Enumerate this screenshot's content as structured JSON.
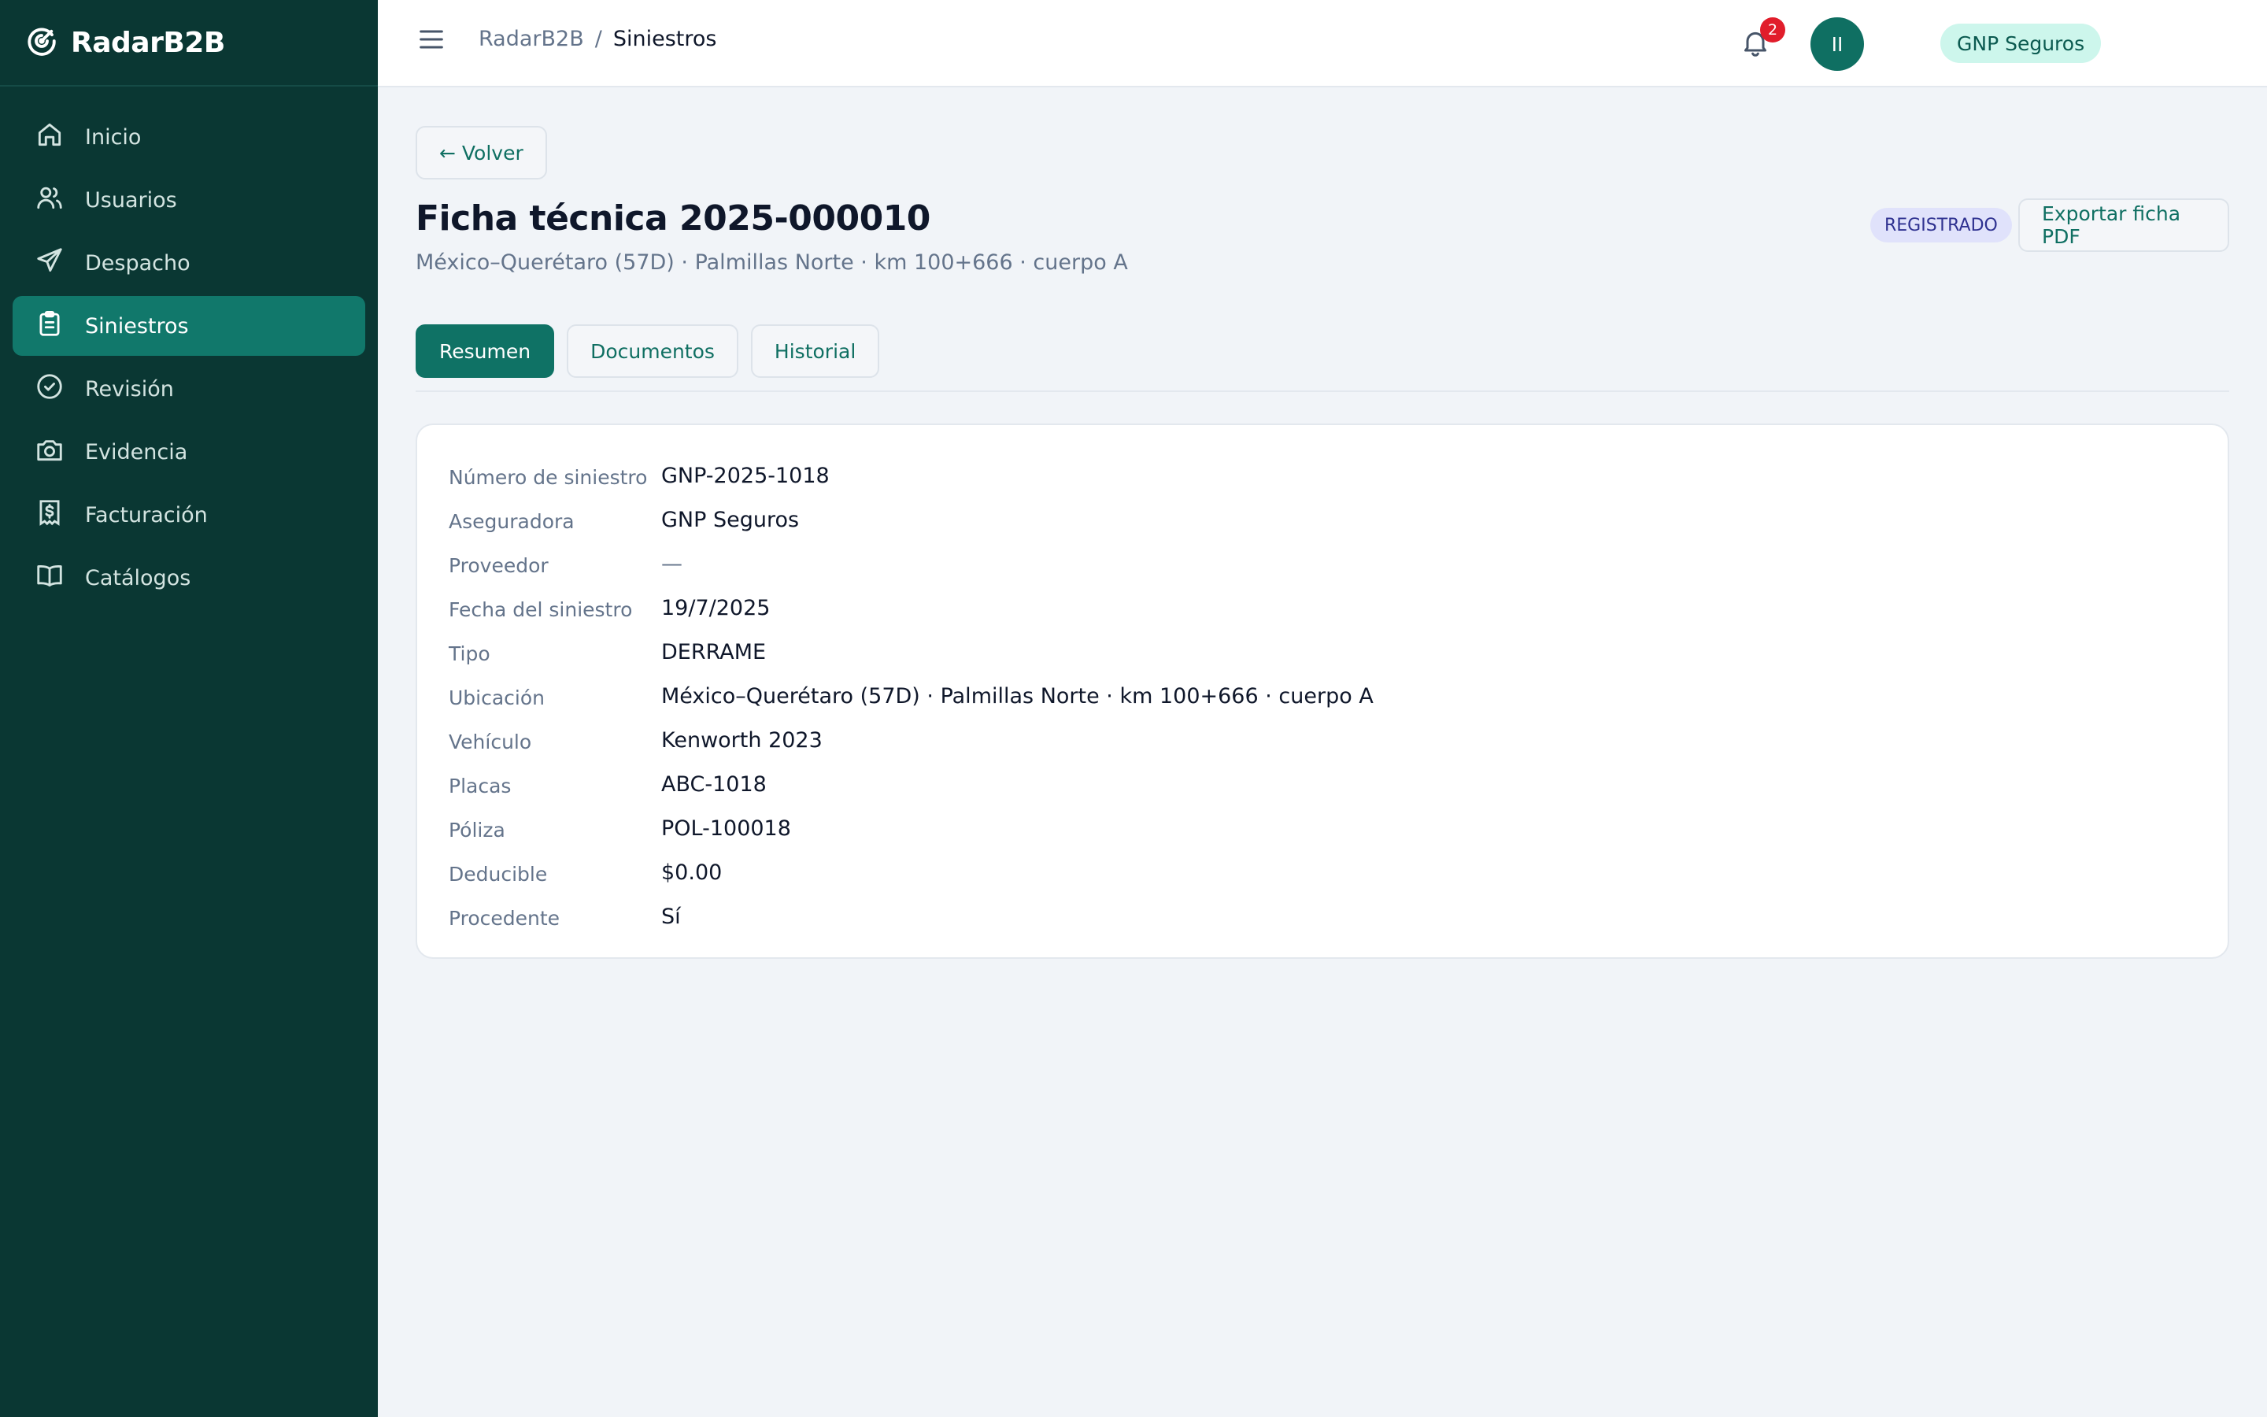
{
  "app": {
    "name": "RadarB2B"
  },
  "sidebar": {
    "items": [
      {
        "label": "Inicio",
        "icon": "home-icon",
        "active": false
      },
      {
        "label": "Usuarios",
        "icon": "users-icon",
        "active": false
      },
      {
        "label": "Despacho",
        "icon": "send-icon",
        "active": false
      },
      {
        "label": "Siniestros",
        "icon": "clipboard-icon",
        "active": true
      },
      {
        "label": "Revisión",
        "icon": "check-circle-icon",
        "active": false
      },
      {
        "label": "Evidencia",
        "icon": "camera-icon",
        "active": false
      },
      {
        "label": "Facturación",
        "icon": "invoice-icon",
        "active": false
      },
      {
        "label": "Catálogos",
        "icon": "book-icon",
        "active": false
      }
    ]
  },
  "header": {
    "breadcrumb_root": "RadarB2B",
    "breadcrumb_sep": "/",
    "breadcrumb_current": "Siniestros",
    "tenant": "GNP Seguros",
    "notifications_count": "2",
    "user_initials": "II"
  },
  "page": {
    "back_label": "← Volver",
    "title": "Ficha técnica 2025-000010",
    "subtitle": "México–Querétaro (57D) · Palmillas Norte · km 100+666 · cuerpo A",
    "status": "REGISTRADO",
    "export_label": "Exportar ficha PDF",
    "tabs": [
      {
        "label": "Resumen",
        "active": true
      },
      {
        "label": "Documentos",
        "active": false
      },
      {
        "label": "Historial",
        "active": false
      }
    ]
  },
  "details": [
    {
      "label": "Número de siniestro",
      "value": "GNP-2025-1018"
    },
    {
      "label": "Aseguradora",
      "value": "GNP Seguros"
    },
    {
      "label": "Proveedor",
      "value": "—"
    },
    {
      "label": "Fecha del siniestro",
      "value": "19/7/2025"
    },
    {
      "label": "Tipo",
      "value": "DERRAME"
    },
    {
      "label": "Ubicación",
      "value": "México–Querétaro (57D) · Palmillas Norte · km 100+666 · cuerpo A"
    },
    {
      "label": "Vehículo",
      "value": "Kenworth 2023"
    },
    {
      "label": "Placas",
      "value": "ABC-1018"
    },
    {
      "label": "Póliza",
      "value": "POL-100018"
    },
    {
      "label": "Deducible",
      "value": "$0.00"
    },
    {
      "label": "Procedente",
      "value": "Sí"
    }
  ],
  "colors": {
    "sidebar_bg": "#0a3733",
    "accent": "#0f7265",
    "badge_red": "#e11d2b",
    "status_bg": "#e0e2fb"
  }
}
